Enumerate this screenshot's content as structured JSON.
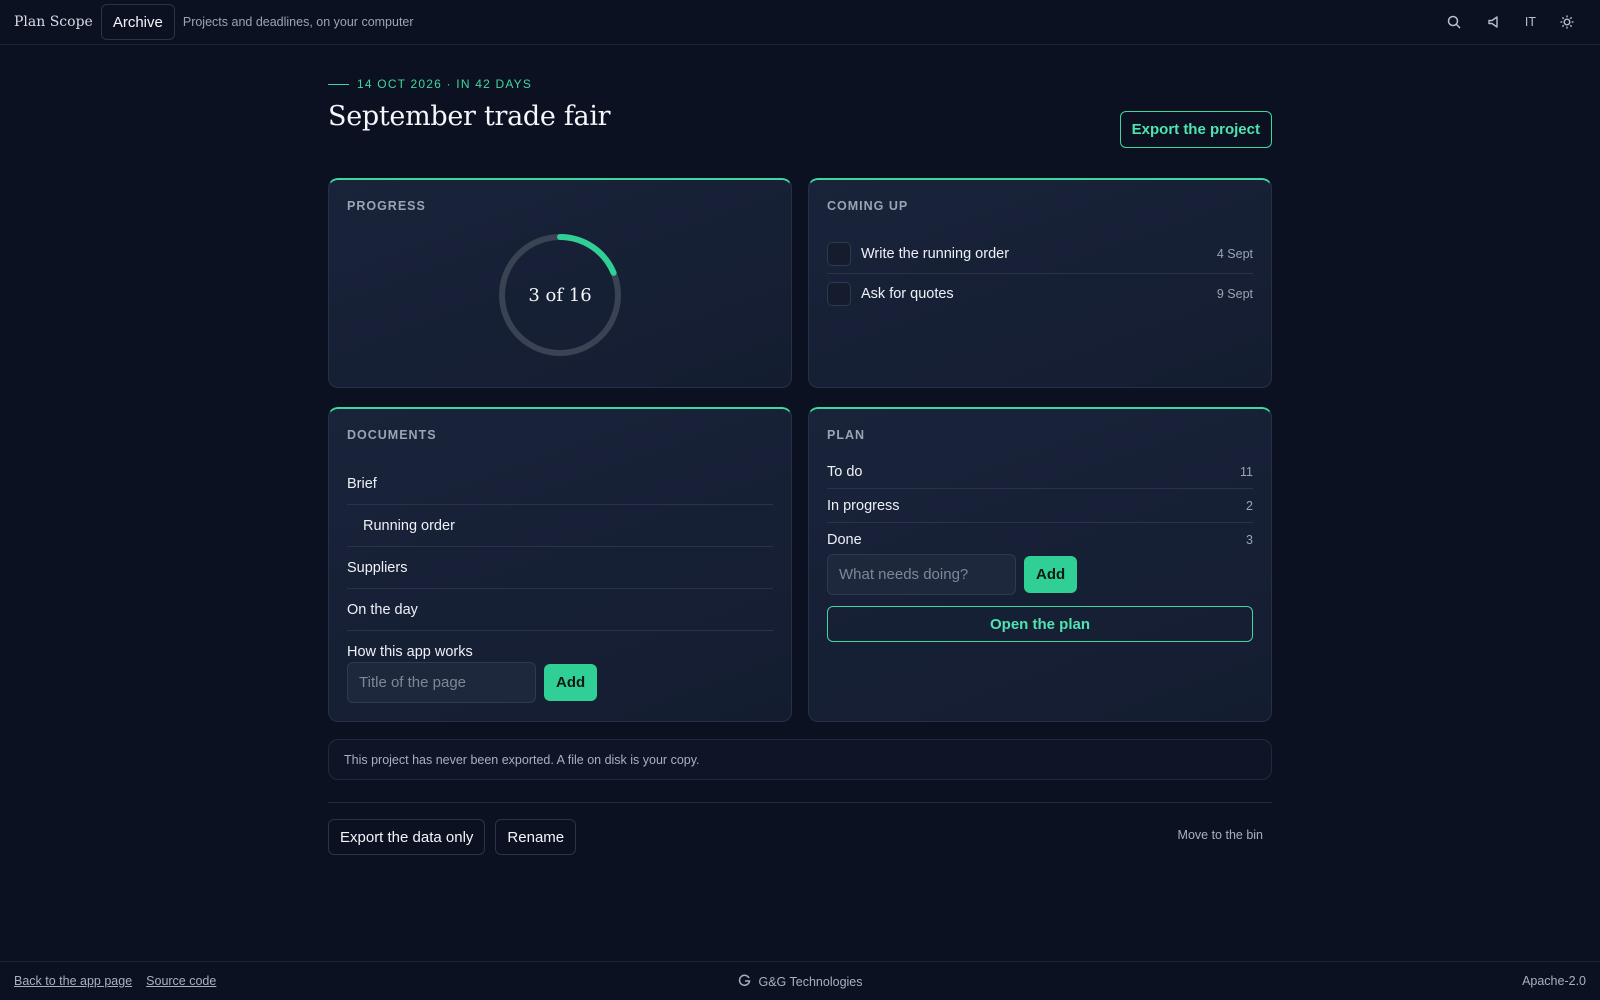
{
  "header": {
    "brand": "Plan Scope",
    "archive_label": "Archive",
    "tagline": "Projects and deadlines, on your computer",
    "language": "IT",
    "icons": [
      "search-icon",
      "megaphone-icon",
      "sun-icon"
    ]
  },
  "project": {
    "eyebrow": "14 OCT 2026 · IN 42 DAYS",
    "title": "September trade fair",
    "export_label": "Export the project"
  },
  "progress": {
    "label": "PROGRESS",
    "done": 3,
    "total": 16,
    "text": "3 of 16"
  },
  "coming_up": {
    "label": "COMING UP",
    "items": [
      {
        "title": "Write the running order",
        "date": "4 Sept",
        "checked": false
      },
      {
        "title": "Ask for quotes",
        "date": "9 Sept",
        "checked": false
      }
    ]
  },
  "documents": {
    "label": "DOCUMENTS",
    "items": [
      {
        "title": "Brief",
        "indent": false
      },
      {
        "title": "Running order",
        "indent": true
      },
      {
        "title": "Suppliers",
        "indent": false
      },
      {
        "title": "On the day",
        "indent": false
      },
      {
        "title": "How this app works",
        "indent": false
      }
    ],
    "input_placeholder": "Title of the page",
    "add_label": "Add"
  },
  "plan": {
    "label": "PLAN",
    "rows": [
      {
        "label": "To do",
        "count": "11"
      },
      {
        "label": "In progress",
        "count": "2"
      },
      {
        "label": "Done",
        "count": "3"
      }
    ],
    "input_placeholder": "What needs doing?",
    "add_label": "Add",
    "open_label": "Open the plan"
  },
  "notice": "This project has never been exported. A file on disk is your copy.",
  "actions": {
    "export_data": "Export the data only",
    "rename": "Rename",
    "bin": "Move to the bin"
  },
  "footer": {
    "back_link": "Back to the app page",
    "source_link": "Source code",
    "company": "G&G Technologies",
    "license": "Apache-2.0"
  },
  "colors": {
    "accent": "#3fd6a0",
    "background": "#0b1120",
    "card": "#19233a"
  }
}
